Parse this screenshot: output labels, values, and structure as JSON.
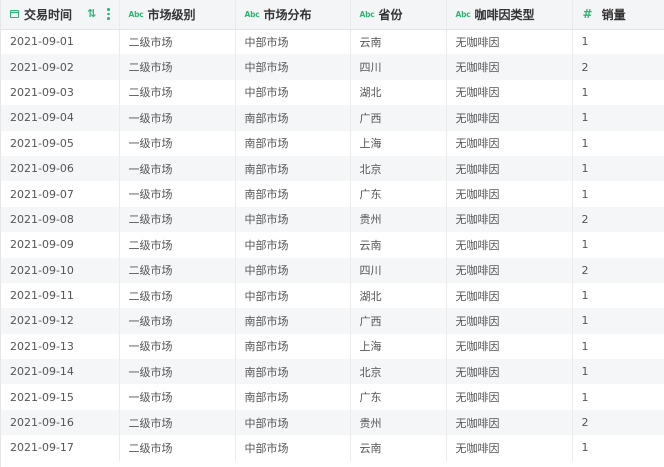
{
  "columns": [
    {
      "label": "交易时间",
      "type_icon": "calendar-icon"
    },
    {
      "label": "市场级别",
      "type_icon": "Abc"
    },
    {
      "label": "市场分布",
      "type_icon": "Abc"
    },
    {
      "label": "省份",
      "type_icon": "Abc"
    },
    {
      "label": "咖啡因类型",
      "type_icon": "Abc"
    },
    {
      "label": "销量",
      "type_icon": "#"
    }
  ],
  "header_icons": {
    "sort": "⇅",
    "more": "vertical-dots-icon"
  },
  "type_labels": {
    "text": "Abc",
    "number": "#"
  },
  "rows": [
    [
      "2021-09-01",
      "二级市场",
      "中部市场",
      "云南",
      "无咖啡因",
      "1"
    ],
    [
      "2021-09-02",
      "二级市场",
      "中部市场",
      "四川",
      "无咖啡因",
      "2"
    ],
    [
      "2021-09-03",
      "二级市场",
      "中部市场",
      "湖北",
      "无咖啡因",
      "1"
    ],
    [
      "2021-09-04",
      "一级市场",
      "南部市场",
      "广西",
      "无咖啡因",
      "1"
    ],
    [
      "2021-09-05",
      "一级市场",
      "南部市场",
      "上海",
      "无咖啡因",
      "1"
    ],
    [
      "2021-09-06",
      "一级市场",
      "南部市场",
      "北京",
      "无咖啡因",
      "1"
    ],
    [
      "2021-09-07",
      "一级市场",
      "南部市场",
      "广东",
      "无咖啡因",
      "1"
    ],
    [
      "2021-09-08",
      "二级市场",
      "中部市场",
      "贵州",
      "无咖啡因",
      "2"
    ],
    [
      "2021-09-09",
      "二级市场",
      "中部市场",
      "云南",
      "无咖啡因",
      "1"
    ],
    [
      "2021-09-10",
      "二级市场",
      "中部市场",
      "四川",
      "无咖啡因",
      "2"
    ],
    [
      "2021-09-11",
      "二级市场",
      "中部市场",
      "湖北",
      "无咖啡因",
      "1"
    ],
    [
      "2021-09-12",
      "一级市场",
      "南部市场",
      "广西",
      "无咖啡因",
      "1"
    ],
    [
      "2021-09-13",
      "一级市场",
      "南部市场",
      "上海",
      "无咖啡因",
      "1"
    ],
    [
      "2021-09-14",
      "一级市场",
      "南部市场",
      "北京",
      "无咖啡因",
      "1"
    ],
    [
      "2021-09-15",
      "一级市场",
      "南部市场",
      "广东",
      "无咖啡因",
      "1"
    ],
    [
      "2021-09-16",
      "二级市场",
      "中部市场",
      "贵州",
      "无咖啡因",
      "2"
    ],
    [
      "2021-09-17",
      "二级市场",
      "中部市场",
      "云南",
      "无咖啡因",
      "1"
    ]
  ],
  "colors": {
    "accent": "#2bb673",
    "header_bg": "#f4f5f7",
    "stripe_bg": "#f5f6f8"
  }
}
